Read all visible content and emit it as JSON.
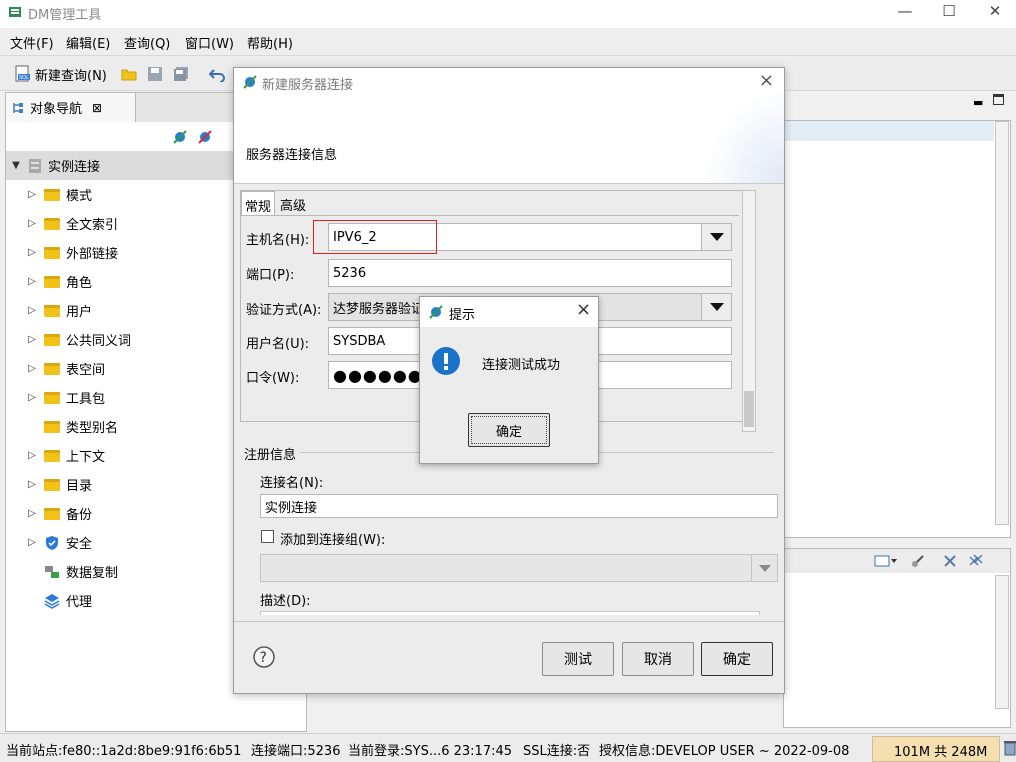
{
  "window": {
    "title": "DM管理工具",
    "minimize": "—",
    "maximize": "☐",
    "close": "✕"
  },
  "menu": [
    "文件(F)",
    "编辑(E)",
    "查询(Q)",
    "窗口(W)",
    "帮助(H)"
  ],
  "toolbar": {
    "new_query": "新建查询(N)"
  },
  "nav": {
    "tab_label": "对象导航",
    "root": "实例连接",
    "items": [
      {
        "label": "模式",
        "expandable": true,
        "icon": "folder"
      },
      {
        "label": "全文索引",
        "expandable": true,
        "icon": "folder"
      },
      {
        "label": "外部链接",
        "expandable": true,
        "icon": "folder"
      },
      {
        "label": "角色",
        "expandable": true,
        "icon": "folder"
      },
      {
        "label": "用户",
        "expandable": true,
        "icon": "folder"
      },
      {
        "label": "公共同义词",
        "expandable": true,
        "icon": "folder"
      },
      {
        "label": "表空间",
        "expandable": true,
        "icon": "folder"
      },
      {
        "label": "工具包",
        "expandable": true,
        "icon": "folder"
      },
      {
        "label": "类型别名",
        "expandable": false,
        "icon": "folder"
      },
      {
        "label": "上下文",
        "expandable": true,
        "icon": "folder"
      },
      {
        "label": "目录",
        "expandable": true,
        "icon": "folder"
      },
      {
        "label": "备份",
        "expandable": true,
        "icon": "folder"
      },
      {
        "label": "安全",
        "expandable": true,
        "icon": "shield"
      },
      {
        "label": "数据复制",
        "expandable": false,
        "icon": "replication"
      },
      {
        "label": "代理",
        "expandable": false,
        "icon": "layers"
      }
    ]
  },
  "dialog": {
    "title": "新建服务器连接",
    "subtitle": "服务器连接信息",
    "tabs": [
      "常规",
      "高级"
    ],
    "host_label": "主机名(H):",
    "host_value": "IPV6_2",
    "port_label": "端口(P):",
    "port_value": "5236",
    "auth_label": "验证方式(A):",
    "auth_value": "达梦服务器验证",
    "user_label": "用户名(U):",
    "user_value": "SYSDBA",
    "pwd_label": "口令(W):",
    "pwd_value": "●●●●●●",
    "reg_section": "注册信息",
    "conn_name_label": "连接名(N):",
    "conn_name_value": "实例连接",
    "add_group_label": "添加到连接组(W):",
    "desc_label": "描述(D):",
    "btn_test": "测试",
    "btn_cancel": "取消",
    "btn_ok": "确定"
  },
  "msgbox": {
    "title": "提示",
    "message": "连接测试成功",
    "ok": "确定"
  },
  "status": {
    "site": "当前站点:fe80::1a2d:8be9:91f6:6b51",
    "port": "连接端口:5236",
    "login": "当前登录:SYS...6 23:17:45",
    "ssl": "SSL连接:否",
    "license": "授权信息:DEVELOP USER ~ 2022-09-08",
    "memory": "101M 共 248M"
  },
  "colors": {
    "selection_bg": "#dcdcdc",
    "folder": "#f2c21a",
    "info_blue": "#1a73c9",
    "host_highlight": "#e02020"
  }
}
